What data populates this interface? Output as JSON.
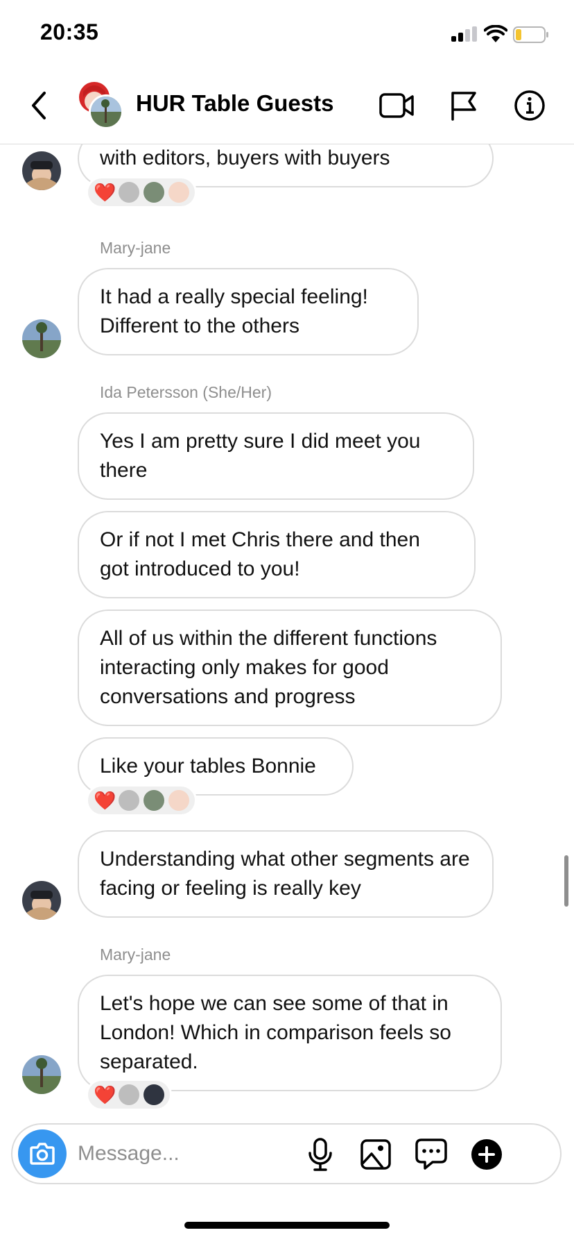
{
  "status_bar": {
    "time": "20:35",
    "icons": [
      "cellular-signal-icon",
      "wifi-icon",
      "battery-low-icon"
    ]
  },
  "header": {
    "title": "HUR Table Guests",
    "icons": [
      "back-chevron-icon",
      "group-avatar",
      "video-call-icon",
      "flag-icon",
      "info-icon"
    ]
  },
  "messages": [
    {
      "text": "with editors, buyers with buyers",
      "reactions": {
        "emoji": "❤️"
      }
    },
    {
      "sender": "Mary-jane",
      "text": "It had a really special feeling! Different to the others"
    },
    {
      "sender": "Ida Petersson (She/Her)",
      "text": "Yes I am pretty sure I did meet you there"
    },
    {
      "text": "Or if not I met Chris there and then got introduced to you!"
    },
    {
      "text": "All of us within the different functions interacting only makes for good conversations and progress"
    },
    {
      "text": "Like your tables Bonnie",
      "reactions": {
        "emoji": "❤️"
      }
    },
    {
      "text": "Understanding what other segments are facing or feeling is really key"
    },
    {
      "sender": "Mary-jane",
      "text": "Let's hope we can see some of that in London! Which in comparison feels so separated.",
      "reactions": {
        "emoji": "❤️"
      }
    }
  ],
  "composer": {
    "placeholder": "Message...",
    "icons": [
      "camera-icon",
      "microphone-icon",
      "gallery-icon",
      "quick-reply-icon",
      "plus-icon"
    ]
  },
  "colors": {
    "accent_blue": "#3797f0",
    "bubble_border": "#dbdbdb",
    "secondary_text": "#8e8e8e",
    "heart_red": "#ed2e44",
    "battery_low": "#f4c430"
  }
}
